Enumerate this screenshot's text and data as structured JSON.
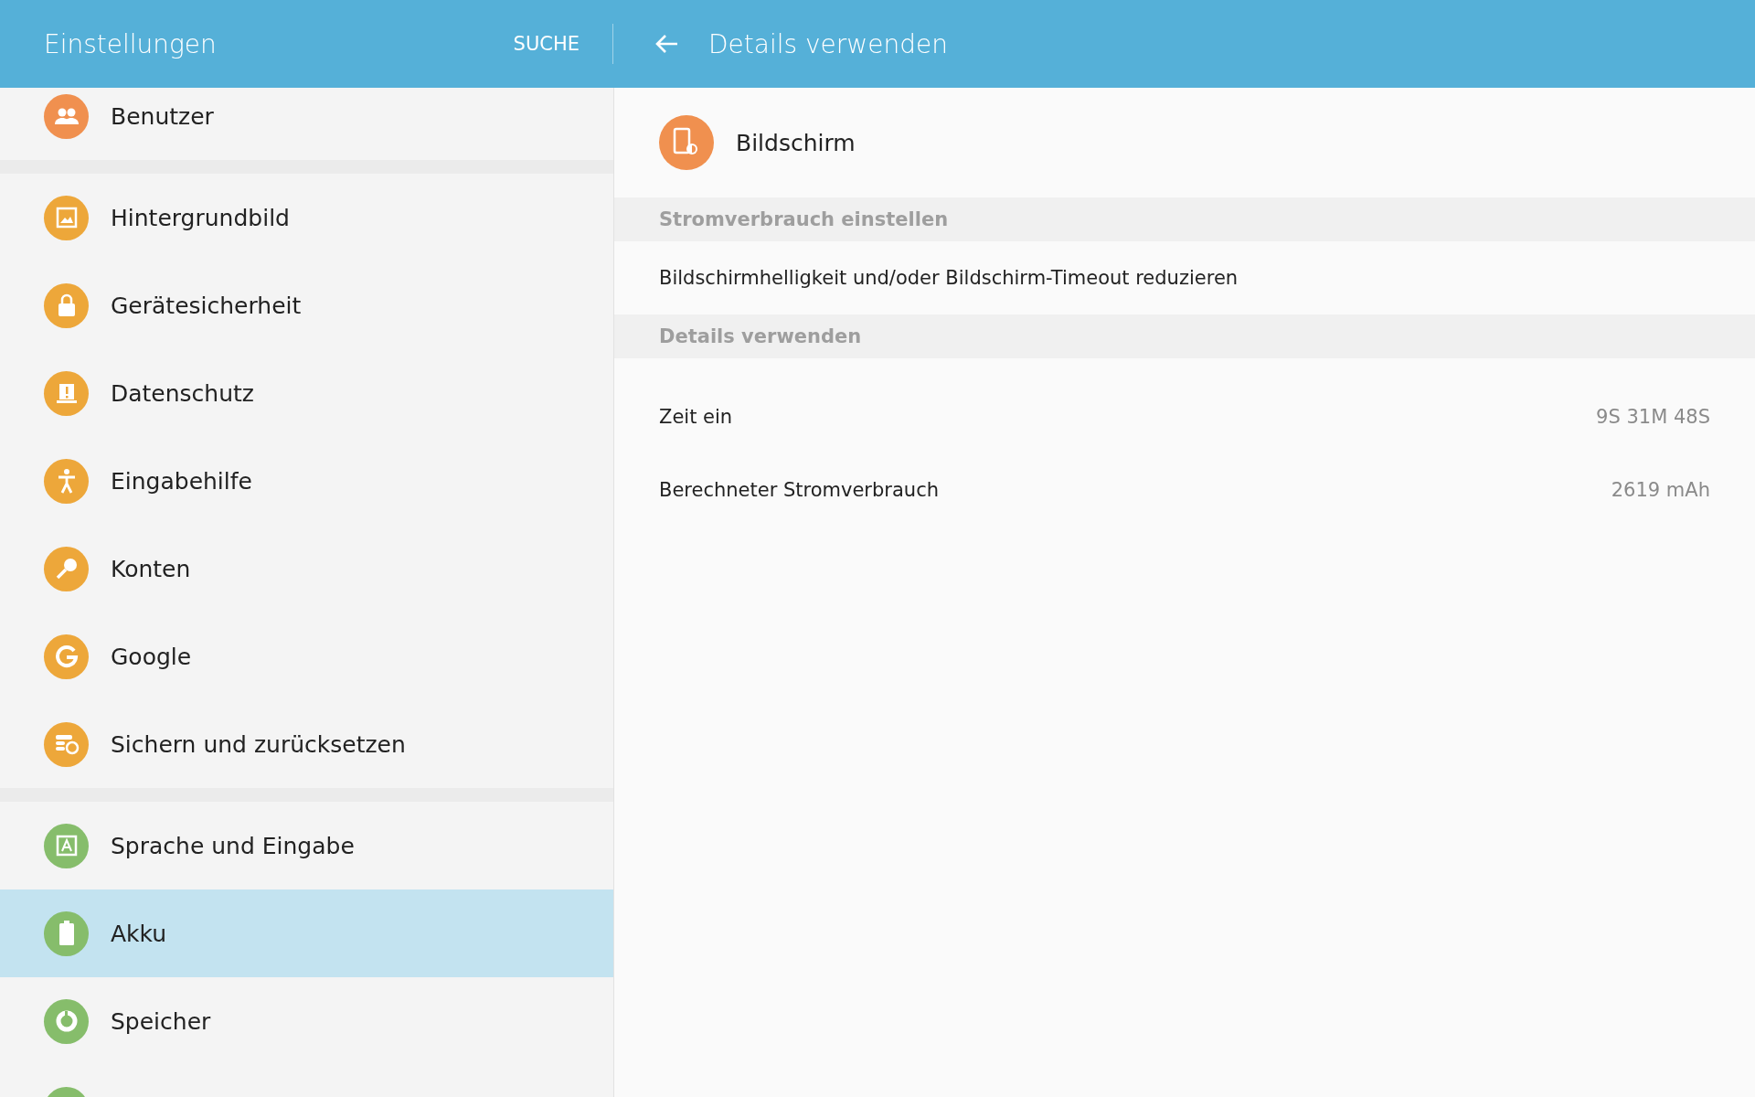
{
  "header": {
    "title": "Einstellungen",
    "search_label": "SUCHE",
    "detail_title": "Details verwenden"
  },
  "sidebar": {
    "groups": [
      {
        "items": [
          {
            "label": "Benutzer",
            "color": "#f0904f",
            "selected": false
          }
        ]
      },
      {
        "items": [
          {
            "label": "Hintergrundbild",
            "color": "#eda73a",
            "selected": false
          },
          {
            "label": "Gerätesicherheit",
            "color": "#eda73a",
            "selected": false
          },
          {
            "label": "Datenschutz",
            "color": "#eda73a",
            "selected": false
          },
          {
            "label": "Eingabehilfe",
            "color": "#eda73a",
            "selected": false
          },
          {
            "label": "Konten",
            "color": "#eda73a",
            "selected": false
          },
          {
            "label": "Google",
            "color": "#eda73a",
            "selected": false
          },
          {
            "label": "Sichern und zurücksetzen",
            "color": "#eda73a",
            "selected": false
          }
        ]
      },
      {
        "items": [
          {
            "label": "Sprache und Eingabe",
            "color": "#86bd6b",
            "selected": false
          },
          {
            "label": "Akku",
            "color": "#86bd6b",
            "selected": true
          },
          {
            "label": "Speicher",
            "color": "#86bd6b",
            "selected": false
          },
          {
            "color": "#86bd6b",
            "selected": false
          }
        ]
      }
    ]
  },
  "detail": {
    "app_name": "Bildschirm",
    "sections": [
      {
        "heading": "Stromverbrauch einstellen",
        "rows": [
          {
            "label": "Bildschirmhelligkeit und/oder Bildschirm-Timeout reduzieren"
          }
        ]
      },
      {
        "heading": "Details verwenden",
        "rows": [
          {
            "label": "Zeit ein",
            "value": "9S 31M 48S"
          },
          {
            "label": "Berechneter Stromverbrauch",
            "value": "2619 mAh"
          }
        ]
      }
    ]
  }
}
